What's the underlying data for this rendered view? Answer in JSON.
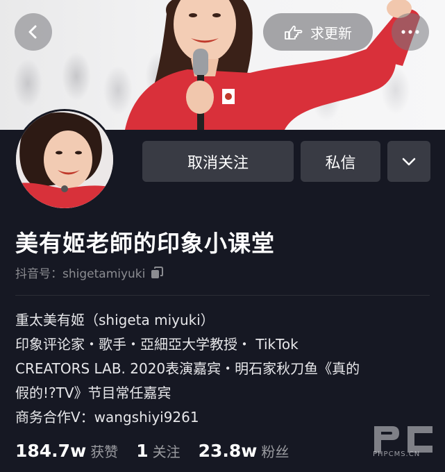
{
  "header": {
    "update_label": "求更新"
  },
  "profile": {
    "nickname": "美有姬老師的印象小课堂",
    "douyin_id_label": "抖音号：",
    "douyin_id": "shigetamiyuki"
  },
  "actions": {
    "unfollow_label": "取消关注",
    "message_label": "私信"
  },
  "bio": {
    "lines": [
      "重太美有姬（shigeta miyuki）",
      "印象评论家・歌手・亞細亞大学教授・ TikTok",
      "CREATORS LAB. 2020表演嘉宾・明石家秋刀鱼《真的",
      "假的!?TV》节目常任嘉宾",
      "商务合作V：wangshiyi9261"
    ]
  },
  "stats": {
    "likes_value": "184.7w",
    "likes_label": "获赞",
    "following_value": "1",
    "following_label": "关注",
    "followers_value": "23.8w",
    "followers_label": "粉丝"
  },
  "watermark": {
    "text": "PHPCMS.CN"
  },
  "colors": {
    "background": "#161823",
    "button": "#393b44",
    "accent_red": "#e23a3a"
  },
  "icons": [
    "back-icon",
    "hand-point-icon",
    "more-icon",
    "copy-icon",
    "chevron-down-icon"
  ]
}
